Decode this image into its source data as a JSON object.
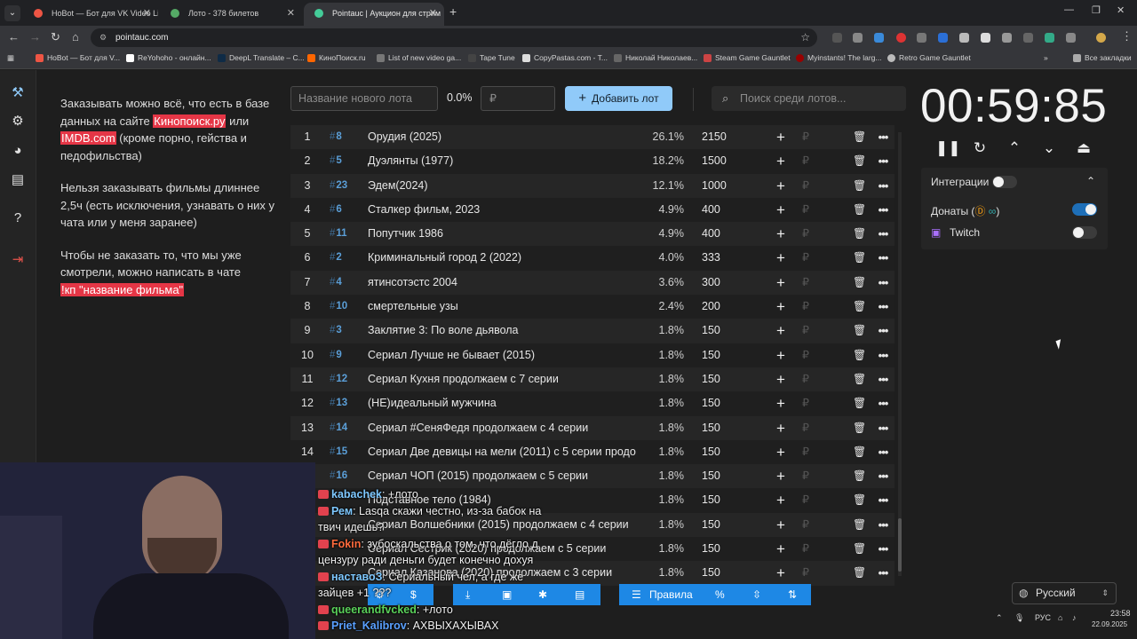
{
  "browser": {
    "tabs": [
      {
        "title": "HoBot — Бот для VK Video Liv",
        "active": false
      },
      {
        "title": "Лото - 378 билетов",
        "active": false
      },
      {
        "title": "Pointauc | Аукцион для стрим",
        "active": true
      }
    ],
    "url": "pointauc.com",
    "bookmarks": [
      "HoBot — Бот для V...",
      "ReYohoho - онлайн...",
      "DeepL Translate – C...",
      "КиноПоиск.ru",
      "List of new video ga...",
      "Tape Tune",
      "CopyPastas.com - T...",
      "Николай Николаев...",
      "Steam Game Gauntlet",
      "Myinstants! The larg...",
      "Retro Game Gauntlet"
    ],
    "bookmarks_all": "Все закладки",
    "window_controls": [
      "—",
      "❐",
      "✕"
    ]
  },
  "rules": {
    "p1_before": "Заказывать можно всё, что есть в базе данных на сайте ",
    "p1_link1": "Кинопоиск.ру",
    "p1_mid": " или ",
    "p1_link2": "IMDB.com",
    "p1_after": " (кроме порно, гейства и педофильства)",
    "p2": "Нельзя заказывать фильмы длиннее 2,5ч (есть исключения, узнавать о них у чата или у меня заранее)",
    "p3": "Чтобы не заказать то, что мы уже смотрели, можно написать в чате",
    "p3_cmd": "!кп \"название фильма\""
  },
  "controls": {
    "lot_placeholder": "Название нового лота",
    "percent": "0.0%",
    "amount_placeholder": "₽",
    "add_button": "Добавить лот",
    "search_placeholder": "Поиск среди лотов..."
  },
  "lots": [
    {
      "n": "1",
      "id": "8",
      "name": "Орудия (2025)",
      "pct": "26.1%",
      "amount": "2150"
    },
    {
      "n": "2",
      "id": "5",
      "name": "Дуэлянты (1977)",
      "pct": "18.2%",
      "amount": "1500"
    },
    {
      "n": "3",
      "id": "23",
      "name": "Эдем(2024)",
      "pct": "12.1%",
      "amount": "1000"
    },
    {
      "n": "4",
      "id": "6",
      "name": "Сталкер фильм, 2023",
      "pct": "4.9%",
      "amount": "400"
    },
    {
      "n": "5",
      "id": "11",
      "name": "Попутчик 1986",
      "pct": "4.9%",
      "amount": "400"
    },
    {
      "n": "6",
      "id": "2",
      "name": "Криминальный город 2 (2022)",
      "pct": "4.0%",
      "amount": "333"
    },
    {
      "n": "7",
      "id": "4",
      "name": "ятинсотэстс 2004",
      "pct": "3.6%",
      "amount": "300"
    },
    {
      "n": "8",
      "id": "10",
      "name": "смертельные узы",
      "pct": "2.4%",
      "amount": "200"
    },
    {
      "n": "9",
      "id": "3",
      "name": "Заклятие 3: По воле дьявола",
      "pct": "1.8%",
      "amount": "150"
    },
    {
      "n": "10",
      "id": "9",
      "name": "Сериал Лучше не бывает (2015)",
      "pct": "1.8%",
      "amount": "150"
    },
    {
      "n": "11",
      "id": "12",
      "name": "Сериал Кухня продолжаем с 7 серии",
      "pct": "1.8%",
      "amount": "150"
    },
    {
      "n": "12",
      "id": "13",
      "name": "(НЕ)идеальный мужчина",
      "pct": "1.8%",
      "amount": "150"
    },
    {
      "n": "13",
      "id": "14",
      "name": "Сериал #СеняФедя продолжаем с 4 серии",
      "pct": "1.8%",
      "amount": "150"
    },
    {
      "n": "14",
      "id": "15",
      "name": "Сериал Две девицы на мели (2011) с 5 серии продо",
      "pct": "1.8%",
      "amount": "150"
    },
    {
      "n": "15",
      "id": "16",
      "name": "Сериал ЧОП (2015) продолжаем с 5 серии",
      "pct": "1.8%",
      "amount": "150"
    },
    {
      "n": "",
      "id": "",
      "name": "Подставное тело (1984)",
      "pct": "1.8%",
      "amount": "150"
    },
    {
      "n": "",
      "id": "",
      "name": "Сериал Волшебники (2015) продолжаем с 4 серии",
      "pct": "1.8%",
      "amount": "150"
    },
    {
      "n": "",
      "id": "",
      "name": "Сериал Сестрик (2020) продолжаем с 5 серии",
      "pct": "1.8%",
      "amount": "150"
    },
    {
      "n": "",
      "id": "",
      "name": "Сериал Казанова (2020) продолжаем с 3 серии",
      "pct": "1.8%",
      "amount": "150"
    }
  ],
  "currency_symbol": "₽",
  "timer": "00:59:85",
  "integrations": {
    "title": "Интеграции",
    "donations": "Донаты (",
    "donations_end": ")",
    "twitch": "Twitch"
  },
  "bottom_toolbar": {
    "rules_button": "Правила",
    "percent_button": "%"
  },
  "language": "Русский",
  "chat": [
    {
      "user": "kabachek",
      "text": ": +лото"
    },
    {
      "user": "Рем",
      "text": ": Lasqa скажи честно, из-за бабок на"
    },
    {
      "user": "",
      "text": "твич идешь?"
    },
    {
      "user": "Fokin",
      "text": ": зубоскальства о том, что дёгло д"
    },
    {
      "user": "",
      "text": "цензуру ради деньги будет конечно дохуя"
    },
    {
      "user": "наставоЗ",
      "text": ": Сериальный чел, а где же"
    },
    {
      "user": "",
      "text": "зайцев +1 ???"
    },
    {
      "user": "queerandfvcked",
      "text": ": +лото"
    },
    {
      "user": "Priet_Kalibrov",
      "text": ": АХВЫХАХЫВАХ"
    }
  ],
  "tray": {
    "lang": "РУС",
    "time": "23:58",
    "date": "22.09.2025"
  },
  "colors": {
    "accent": "#90caf9",
    "highlight": "#e53646",
    "toolbar_blue": "#1e88e5",
    "id_blue": "#5b9fd8"
  }
}
